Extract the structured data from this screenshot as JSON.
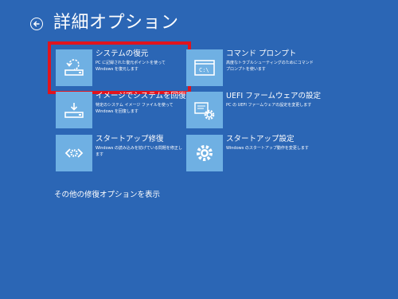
{
  "header": {
    "back_icon": "back-arrow-icon",
    "title": "詳細オプション"
  },
  "options": [
    {
      "title": "システムの復元",
      "desc": "PC に記録された復元ポイントを使って Windows を復元します",
      "icon": "system-restore-icon",
      "highlighted": true
    },
    {
      "title": "コマンド プロンプト",
      "desc": "高度なトラブルシューティングのためにコマンド プロンプトを使います",
      "icon": "command-prompt-icon"
    },
    {
      "title": "イメージでシステムを回復",
      "desc": "特定のシステム イメージ ファイルを使って Windows を回復します",
      "icon": "system-image-recovery-icon"
    },
    {
      "title": "UEFI ファームウェアの設定",
      "desc": "PC の UEFI ファームウェアの設定を変更します",
      "icon": "uefi-firmware-settings-icon"
    },
    {
      "title": "スタートアップ修復",
      "desc": "Windows の読み込みを妨げている問題を修正します",
      "icon": "startup-repair-icon"
    },
    {
      "title": "スタートアップ設定",
      "desc": "Windows のスタートアップ動作を変更します",
      "icon": "startup-settings-icon"
    }
  ],
  "more_link": "その他の修復オプションを表示",
  "colors": {
    "background": "#2b66b5",
    "tile_icon": "#6fb0e3",
    "highlight": "#e0141e"
  }
}
